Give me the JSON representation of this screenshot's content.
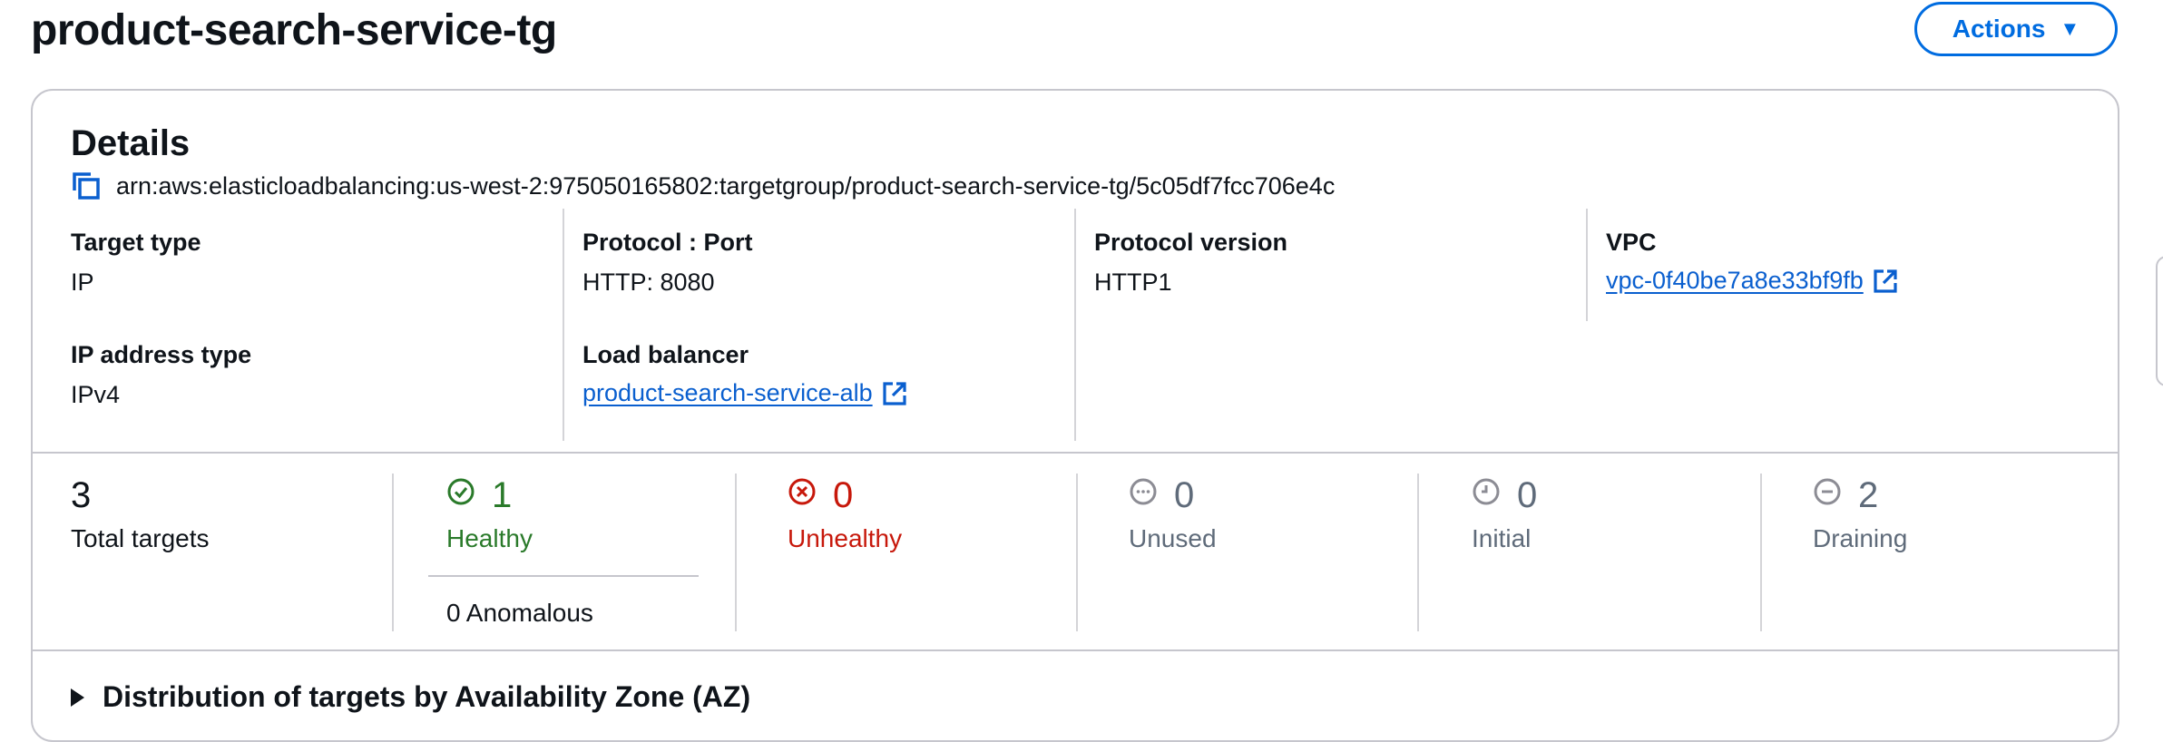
{
  "header": {
    "title": "product-search-service-tg",
    "actions_label": "Actions"
  },
  "details": {
    "heading": "Details",
    "arn": "arn:aws:elasticloadbalancing:us-west-2:975050165802:targetgroup/product-search-service-tg/5c05df7fcc706e4c",
    "target_type": {
      "label": "Target type",
      "value": "IP"
    },
    "protocol_port": {
      "label": "Protocol : Port",
      "value": "HTTP: 8080"
    },
    "protocol_version": {
      "label": "Protocol version",
      "value": "HTTP1"
    },
    "vpc": {
      "label": "VPC",
      "value": "vpc-0f40be7a8e33bf9fb"
    },
    "ip_address_type": {
      "label": "IP address type",
      "value": "IPv4"
    },
    "load_balancer": {
      "label": "Load balancer",
      "value": "product-search-service-alb"
    }
  },
  "stats": {
    "total": {
      "count": "3",
      "label": "Total targets"
    },
    "healthy": {
      "count": "1",
      "label": "Healthy",
      "anomalous": "0 Anomalous"
    },
    "unhealthy": {
      "count": "0",
      "label": "Unhealthy"
    },
    "unused": {
      "count": "0",
      "label": "Unused"
    },
    "initial": {
      "count": "0",
      "label": "Initial"
    },
    "draining": {
      "count": "2",
      "label": "Draining"
    }
  },
  "distribution": {
    "label": "Distribution of targets by Availability Zone (AZ)"
  },
  "colors": {
    "link": "#0a5fcf",
    "healthy": "#2a7a2a",
    "unhealthy": "#c7180b",
    "neutral": "#5f6b7a"
  },
  "icons": {
    "copy": "copy-icon",
    "external": "external-link-icon",
    "healthy": "check-circle-icon",
    "unhealthy": "x-circle-icon",
    "unused": "dots-circle-icon",
    "initial": "clock-circle-icon",
    "draining": "minus-circle-icon",
    "actions": "caret-down-icon",
    "distribution": "caret-right-icon"
  }
}
